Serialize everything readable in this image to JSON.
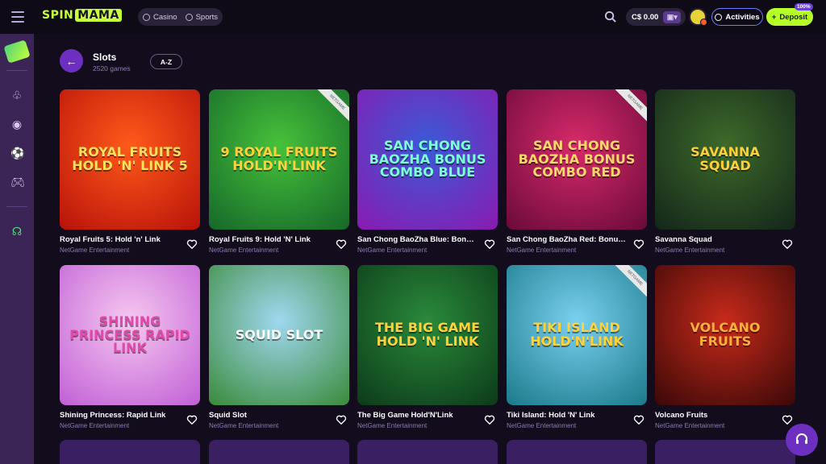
{
  "header": {
    "logo_spin": "SPIN",
    "logo_mama": "MAMA",
    "tabs": [
      {
        "label": "Casino"
      },
      {
        "label": "Sports"
      }
    ],
    "balance": "C$ 0.00",
    "activities_label": "Activities",
    "deposit_label": "Deposit",
    "deposit_badge": "100%"
  },
  "section": {
    "title": "Slots",
    "count": "2520 games",
    "sort_label": "A-Z"
  },
  "games": [
    {
      "title": "Royal Fruits 5: Hold 'n' Link",
      "provider": "NetGame Entertainment",
      "art": "ROYAL FRUITS HOLD 'N' LINK 5",
      "bg1": "#ff5a1a",
      "bg2": "#b8120a",
      "fg": "#ffe25a"
    },
    {
      "title": "Royal Fruits 9: Hold 'N' Link",
      "provider": "NetGame Entertainment",
      "art": "9 ROYAL FRUITS HOLD'N'LINK",
      "bg1": "#46c23a",
      "bg2": "#16682a",
      "fg": "#ffd23a"
    },
    {
      "title": "San Chong BaoZha Blue: Bonus Combo",
      "provider": "NetGame Entertainment",
      "art": "SAN CHONG BAOZHA BONUS COMBO BLUE",
      "bg1": "#3a5ad8",
      "bg2": "#8a1ab0",
      "fg": "#7affd6"
    },
    {
      "title": "San Chong BaoZha Red: Bonus Combo",
      "provider": "NetGame Entertainment",
      "art": "SAN CHONG BAOZHA BONUS COMBO RED",
      "bg1": "#d82a6a",
      "bg2": "#6a0a3a",
      "fg": "#ffd86a"
    },
    {
      "title": "Savanna Squad",
      "provider": "NetGame Entertainment",
      "art": "SAVANNA SQUAD",
      "bg1": "#3e6a2a",
      "bg2": "#13261a",
      "fg": "#ffcf3a"
    },
    {
      "title": "Shining Princess: Rapid Link",
      "provider": "NetGame Entertainment",
      "art": "SHINING PRINCESS RAPID LINK",
      "bg1": "#f6c8f0",
      "bg2": "#c15fd6",
      "fg": "#e04aa8"
    },
    {
      "title": "Squid Slot",
      "provider": "NetGame Entertainment",
      "art": "SQUID SLOT",
      "bg1": "#9fd8f0",
      "bg2": "#3a8a3a",
      "fg": "#ffffff"
    },
    {
      "title": "The Big Game Hold'N'Link",
      "provider": "NetGame Entertainment",
      "art": "THE BIG GAME HOLD 'N' LINK",
      "bg1": "#2a8a3a",
      "bg2": "#0c3a1a",
      "fg": "#ffd23a"
    },
    {
      "title": "Tiki Island: Hold 'N' Link",
      "provider": "NetGame Entertainment",
      "art": "TIKI ISLAND HOLD'N'LINK",
      "bg1": "#7ad0f0",
      "bg2": "#1a7a8a",
      "fg": "#ffd23a"
    },
    {
      "title": "Volcano Fruits",
      "provider": "NetGame Entertainment",
      "art": "VOLCANO FRUITS",
      "bg1": "#c82a1a",
      "bg2": "#3a0808",
      "fg": "#ffb03a"
    }
  ],
  "ribbon_label": "NETGAME"
}
